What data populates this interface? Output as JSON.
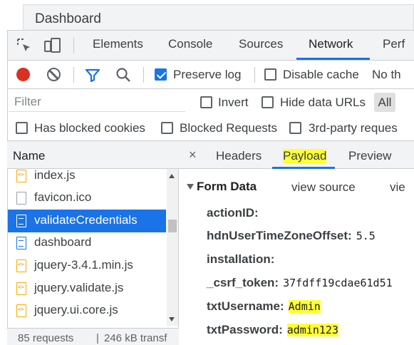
{
  "page": {
    "title": "Dashboard"
  },
  "devtools": {
    "tabs": [
      {
        "label": "Elements"
      },
      {
        "label": "Console"
      },
      {
        "label": "Sources"
      },
      {
        "label": "Network",
        "active": true
      },
      {
        "label": "Perf"
      }
    ],
    "toolbar": {
      "preserve_log": {
        "label": "Preserve log",
        "checked": true
      },
      "disable_cache": {
        "label": "Disable cache",
        "checked": false
      },
      "throttle_label": "No th"
    },
    "filter": {
      "placeholder": "Filter",
      "invert": {
        "label": "Invert",
        "checked": false
      },
      "hide_data_urls": {
        "label": "Hide data URLs",
        "checked": false
      },
      "all_chip": "All"
    },
    "options": {
      "blocked_cookies": {
        "label": "Has blocked cookies",
        "checked": false
      },
      "blocked_requests": {
        "label": "Blocked Requests",
        "checked": false
      },
      "third_party": {
        "label": "3rd-party reques",
        "checked": false
      }
    },
    "requests": {
      "header": "Name",
      "items": [
        {
          "name": "index.js",
          "icon": "js-file-icon"
        },
        {
          "name": "favicon.ico",
          "icon": "file-icon"
        },
        {
          "name": "validateCredentials",
          "icon": "document-icon",
          "selected": true
        },
        {
          "name": "dashboard",
          "icon": "document-icon"
        },
        {
          "name": "jquery-3.4.1.min.js",
          "icon": "js-file-icon"
        },
        {
          "name": "jquery.validate.js",
          "icon": "js-file-icon"
        },
        {
          "name": "jquery.ui.core.js",
          "icon": "js-file-icon"
        }
      ],
      "status": {
        "requests": "85 requests",
        "transferred": "246 kB transf"
      }
    },
    "detail": {
      "tabs": [
        {
          "label": "Headers"
        },
        {
          "label": "Payload",
          "active": true
        },
        {
          "label": "Preview"
        }
      ],
      "section_title": "Form Data",
      "view_source": "view source",
      "view_url": "vie",
      "fields": [
        {
          "key": "actionID:",
          "value": ""
        },
        {
          "key": "hdnUserTimeZoneOffset:",
          "value": "5.5"
        },
        {
          "key": "installation:",
          "value": ""
        },
        {
          "key": "_csrf_token:",
          "value": "37fdff19cdae61d51"
        },
        {
          "key": "txtUsername:",
          "value": "Admin"
        },
        {
          "key": "txtPassword:",
          "value": "admin123"
        }
      ]
    }
  },
  "colors": {
    "accent": "#1a73e8",
    "record": "#d93025",
    "highlight": "#ffff33"
  }
}
